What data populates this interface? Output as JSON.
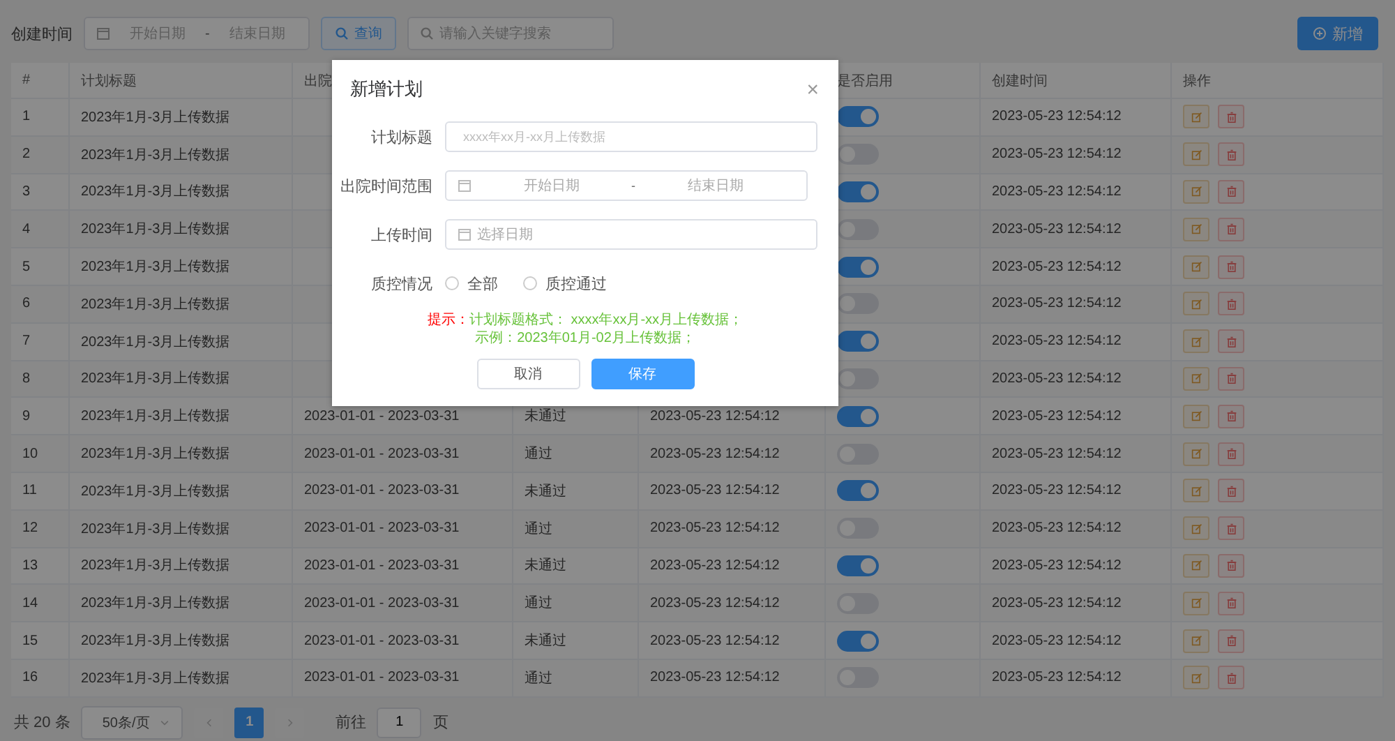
{
  "filter": {
    "label": "创建时间",
    "start_placeholder": "开始日期",
    "separator": "-",
    "end_placeholder": "结束日期",
    "query_button": "查询",
    "search_placeholder": "请输入关键字搜索",
    "add_button": "新增"
  },
  "table": {
    "columns": [
      {
        "label": "#"
      },
      {
        "label": "计划标题"
      },
      {
        "label": "出院"
      },
      {},
      {},
      {
        "label": "是否启用"
      },
      {
        "label": "创建时间"
      },
      {
        "label": "操作"
      }
    ],
    "rows": [
      {
        "index": "1",
        "title": "2023年1月-3月上传数据",
        "enabled": true,
        "created": "2023-05-23 12:54:12"
      },
      {
        "index": "2",
        "title": "2023年1月-3月上传数据",
        "enabled": false,
        "created": "2023-05-23 12:54:12"
      },
      {
        "index": "3",
        "title": "2023年1月-3月上传数据",
        "enabled": true,
        "created": "2023-05-23 12:54:12"
      },
      {
        "index": "4",
        "title": "2023年1月-3月上传数据",
        "enabled": false,
        "created": "2023-05-23 12:54:12"
      },
      {
        "index": "5",
        "title": "2023年1月-3月上传数据",
        "enabled": true,
        "created": "2023-05-23 12:54:12"
      },
      {
        "index": "6",
        "title": "2023年1月-3月上传数据",
        "enabled": false,
        "created": "2023-05-23 12:54:12"
      },
      {
        "index": "7",
        "title": "2023年1月-3月上传数据",
        "enabled": true,
        "created": "2023-05-23 12:54:12"
      },
      {
        "index": "8",
        "title": "2023年1月-3月上传数据",
        "enabled": false,
        "created": "2023-05-23 12:54:12"
      },
      {
        "index": "9",
        "title": "2023年1月-3月上传数据",
        "range": "2023-01-01 - 2023-03-31",
        "qc": "未通过",
        "upload": "2023-05-23 12:54:12",
        "enabled": true,
        "created": "2023-05-23 12:54:12"
      },
      {
        "index": "10",
        "title": "2023年1月-3月上传数据",
        "range": "2023-01-01 - 2023-03-31",
        "qc": "通过",
        "upload": "2023-05-23 12:54:12",
        "enabled": false,
        "created": "2023-05-23 12:54:12"
      },
      {
        "index": "11",
        "title": "2023年1月-3月上传数据",
        "range": "2023-01-01 - 2023-03-31",
        "qc": "未通过",
        "upload": "2023-05-23 12:54:12",
        "enabled": true,
        "created": "2023-05-23 12:54:12"
      },
      {
        "index": "12",
        "title": "2023年1月-3月上传数据",
        "range": "2023-01-01 - 2023-03-31",
        "qc": "通过",
        "upload": "2023-05-23 12:54:12",
        "enabled": false,
        "created": "2023-05-23 12:54:12"
      },
      {
        "index": "13",
        "title": "2023年1月-3月上传数据",
        "range": "2023-01-01 - 2023-03-31",
        "qc": "未通过",
        "upload": "2023-05-23 12:54:12",
        "enabled": true,
        "created": "2023-05-23 12:54:12"
      },
      {
        "index": "14",
        "title": "2023年1月-3月上传数据",
        "range": "2023-01-01 - 2023-03-31",
        "qc": "通过",
        "upload": "2023-05-23 12:54:12",
        "enabled": false,
        "created": "2023-05-23 12:54:12"
      },
      {
        "index": "15",
        "title": "2023年1月-3月上传数据",
        "range": "2023-01-01 - 2023-03-31",
        "qc": "未通过",
        "upload": "2023-05-23 12:54:12",
        "enabled": true,
        "created": "2023-05-23 12:54:12"
      },
      {
        "index": "16",
        "title": "2023年1月-3月上传数据",
        "range": "2023-01-01 - 2023-03-31",
        "qc": "通过",
        "upload": "2023-05-23 12:54:12",
        "enabled": false,
        "created": "2023-05-23 12:54:12"
      }
    ]
  },
  "pagination": {
    "total": "共 20 条",
    "page_size": "50条/页",
    "pages": [
      {
        "label": "1",
        "selected": true
      }
    ],
    "goto_label": "前往",
    "goto_value": "1",
    "goto_suffix": "页"
  },
  "dialog": {
    "title": "新增计划",
    "close": "×",
    "fields": [
      {
        "kind": "text",
        "label": "计划标题",
        "placeholder": "xxxx年xx月-xx月上传数据"
      },
      {
        "kind": "range",
        "label": "出院时间范围",
        "start_placeholder": "开始日期",
        "separator": "-",
        "end_placeholder": "结束日期"
      },
      {
        "kind": "date",
        "label": "上传时间",
        "placeholder": "选择日期"
      },
      {
        "kind": "radio",
        "label": "质控情况",
        "options": [
          {
            "label": "全部",
            "checked": false
          },
          {
            "label": "质控通过",
            "checked": false
          }
        ]
      }
    ],
    "hint": {
      "label": "提示：",
      "lines": [
        "计划标题格式： xxxx年xx月-xx月上传数据；",
        "示例：2023年01月-02月上传数据；"
      ]
    },
    "buttons": [
      {
        "kind": "secondary",
        "label": "取消"
      },
      {
        "kind": "primary",
        "label": "保存"
      }
    ]
  }
}
